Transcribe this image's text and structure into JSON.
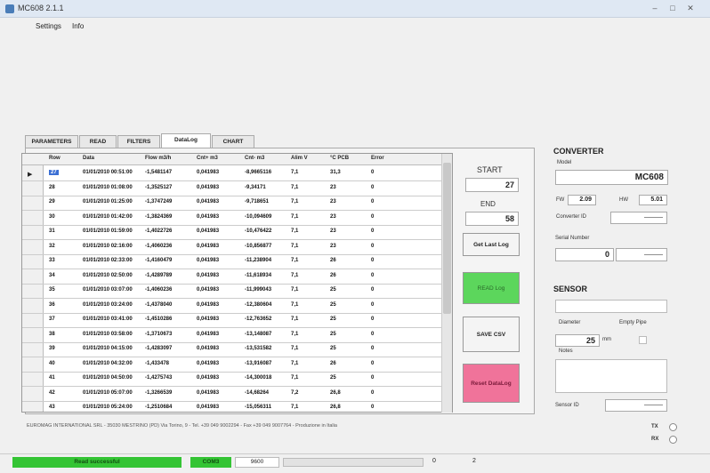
{
  "window": {
    "title": "MC608 2.1.1",
    "controls": [
      "–",
      "□",
      "✕"
    ]
  },
  "menu": {
    "items": [
      "Settings",
      "Info"
    ]
  },
  "tabs": [
    "PARAMETERS",
    "READ",
    "FILTERS",
    "DataLog",
    "CHART"
  ],
  "active_tab": "DataLog",
  "table": {
    "columns": [
      "Row",
      "Data",
      "Flow m3/h",
      "Cnt+ m3",
      "Cnt- m3",
      "Alim V",
      "°C PCB",
      "Error"
    ],
    "rows": [
      [
        "27",
        "01/01/2010 00:51:00",
        "-1,5481147",
        "0,041983",
        "-8,9665116",
        "7,1",
        "31,3",
        "0"
      ],
      [
        "28",
        "01/01/2010 01:08:00",
        "-1,3525127",
        "0,041983",
        "-9,34171",
        "7,1",
        "23",
        "0"
      ],
      [
        "29",
        "01/01/2010 01:25:00",
        "-1,3747249",
        "0,041983",
        "-9,718651",
        "7,1",
        "23",
        "0"
      ],
      [
        "30",
        "01/01/2010 01:42:00",
        "-1,3824369",
        "0,041983",
        "-10,094609",
        "7,1",
        "23",
        "0"
      ],
      [
        "31",
        "01/01/2010 01:59:00",
        "-1,4022726",
        "0,041983",
        "-10,476422",
        "7,1",
        "23",
        "0"
      ],
      [
        "32",
        "01/01/2010 02:16:00",
        "-1,4060236",
        "0,041983",
        "-10,856877",
        "7,1",
        "23",
        "0"
      ],
      [
        "33",
        "01/01/2010 02:33:00",
        "-1,4160479",
        "0,041983",
        "-11,238904",
        "7,1",
        "26",
        "0"
      ],
      [
        "34",
        "01/01/2010 02:50:00",
        "-1,4289789",
        "0,041983",
        "-11,618934",
        "7,1",
        "26",
        "0"
      ],
      [
        "35",
        "01/01/2010 03:07:00",
        "-1,4060236",
        "0,041983",
        "-11,999043",
        "7,1",
        "25",
        "0"
      ],
      [
        "36",
        "01/01/2010 03:24:00",
        "-1,4378040",
        "0,041983",
        "-12,380604",
        "7,1",
        "25",
        "0"
      ],
      [
        "37",
        "01/01/2010 03:41:00",
        "-1,4510286",
        "0,041983",
        "-12,763652",
        "7,1",
        "25",
        "0"
      ],
      [
        "38",
        "01/01/2010 03:58:00",
        "-1,3710673",
        "0,041983",
        "-13,148087",
        "7,1",
        "25",
        "0"
      ],
      [
        "39",
        "01/01/2010 04:15:00",
        "-1,4283097",
        "0,041983",
        "-13,531582",
        "7,1",
        "25",
        "0"
      ],
      [
        "40",
        "01/01/2010 04:32:00",
        "-1,433478",
        "0,041983",
        "-13,916087",
        "7,1",
        "26",
        "0"
      ],
      [
        "41",
        "01/01/2010 04:50:00",
        "-1,4275743",
        "0,041983",
        "-14,300018",
        "7,1",
        "25",
        "0"
      ],
      [
        "42",
        "01/01/2010 05:07:00",
        "-1,3266539",
        "0,041983",
        "-14,68264",
        "7,2",
        "26,8",
        "0"
      ],
      [
        "43",
        "01/01/2010 05:24:00",
        "-1,2510684",
        "0,041983",
        "-15,056311",
        "7,1",
        "26,8",
        "0"
      ]
    ]
  },
  "controls": {
    "start_label": "START",
    "start_value": "27",
    "end_label": "END",
    "end_value": "58",
    "get_last_log": "Get Last Log",
    "read_log": "READ Log",
    "save_csv": "SAVE CSV",
    "reset_datalog": "Reset DataLog",
    "colors": {
      "read_log": "#5cd65c",
      "reset": "#f0739a"
    }
  },
  "converter": {
    "title": "CONVERTER",
    "model_label": "Model",
    "model_value": "MC608",
    "fw_label": "FW",
    "fw_value": "2.09",
    "hw_label": "HW",
    "hw_value": "5.01",
    "converter_id_label": "Converter ID",
    "converter_id_value": "———",
    "serial_label": "Serial Number",
    "serial_value": "0",
    "serial_extra": "———"
  },
  "sensor": {
    "title": "SENSOR",
    "diameter_label": "Diameter",
    "diameter_value": "25",
    "diameter_unit": "mm",
    "empty_pipe_label": "Empty Pipe",
    "notes_label": "Notes",
    "sensor_id_label": "Sensor ID",
    "sensor_id_value": "———"
  },
  "indicators": {
    "tx_label": "TX",
    "rx_label": "RX"
  },
  "footer_text": "EUROMAG INTERNATIONAL SRL - 35030 MESTRINO (PD) Via Torino, 9 - Tel. +39 049 9002294 - Fax +39 049 9007764 - Produzione in Italia",
  "status": {
    "message": "Read successful",
    "port": "COM3",
    "baud": "9600",
    "progress_value": 0,
    "num1": "0",
    "num2": "2"
  }
}
